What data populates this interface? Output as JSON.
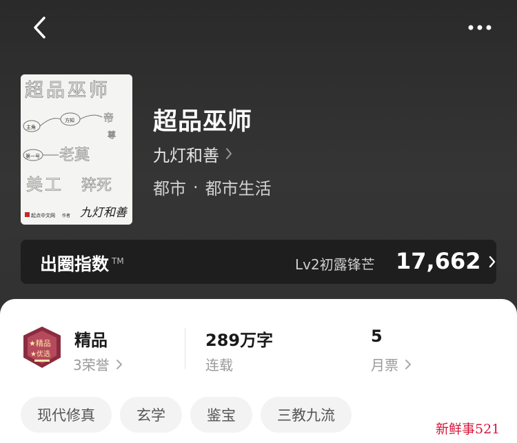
{
  "book": {
    "title": "超品巫师",
    "author": "九灯和善",
    "genre": "都市",
    "separator": "·",
    "subgenre": "都市生活"
  },
  "cover": {
    "title_text": "超品巫师",
    "node_1": "主角",
    "node_2": "方知",
    "node_3": "第一号",
    "publisher": "起点中文网",
    "author_suffix": "作者"
  },
  "index_bar": {
    "label": "出圈指数",
    "tm": "TM",
    "level": "Lv2初露锋芒",
    "value": "17,662"
  },
  "stats": {
    "quality": {
      "title": "精品",
      "honors": "3荣誉"
    },
    "words": {
      "number": "289",
      "unit": "万字",
      "status": "连载"
    },
    "tickets": {
      "number": "5",
      "label": "月票"
    }
  },
  "tags": [
    "现代修真",
    "玄学",
    "鉴宝",
    "三教九流"
  ],
  "watermark": "新鲜事521",
  "colors": {
    "accent_badge": "#8b2b3f",
    "watermark": "#d6163a"
  }
}
